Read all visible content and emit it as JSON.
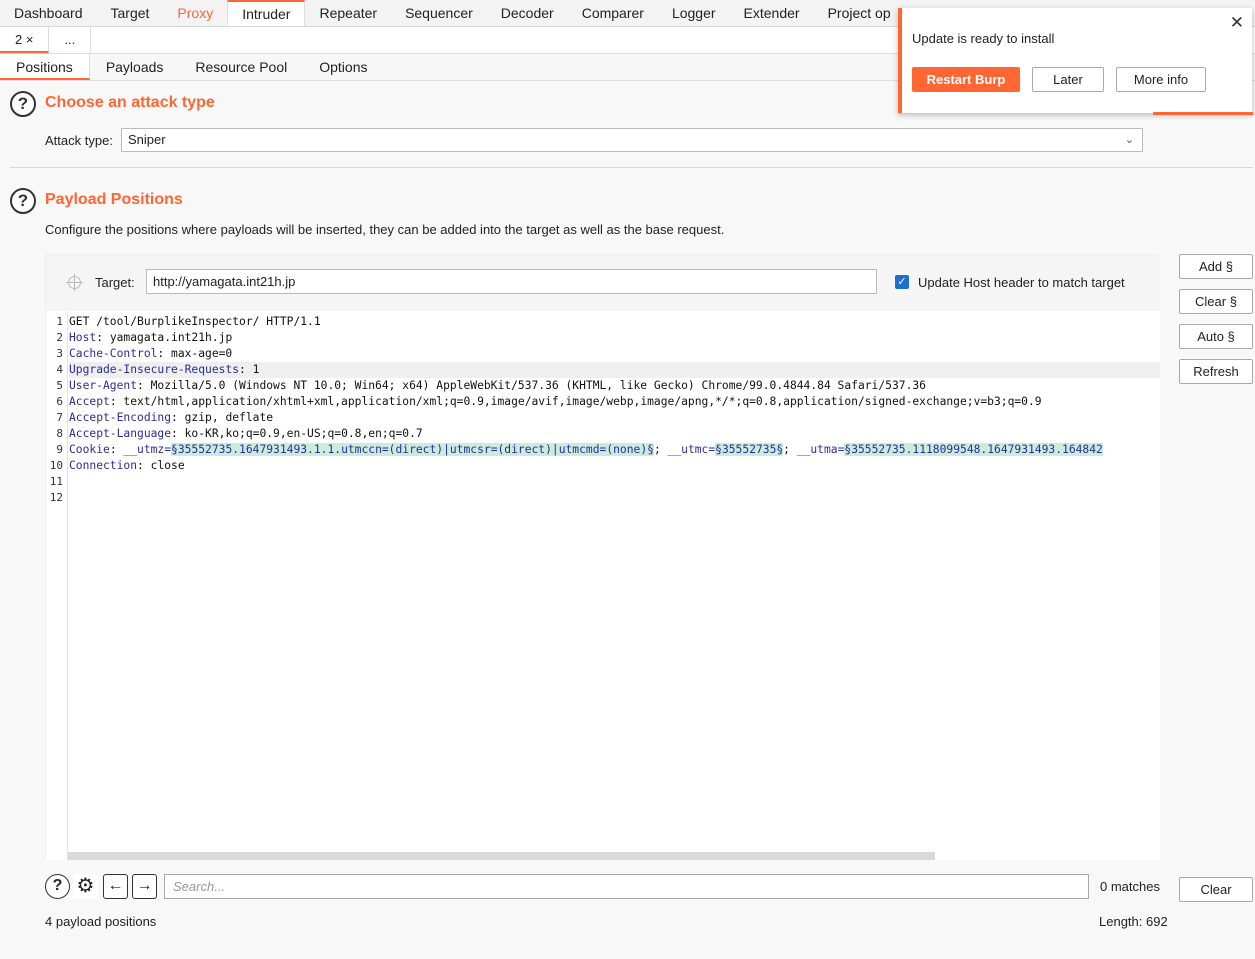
{
  "top_tabs": [
    "Dashboard",
    "Target",
    "Proxy",
    "Intruder",
    "Repeater",
    "Sequencer",
    "Decoder",
    "Comparer",
    "Logger",
    "Extender",
    "Project op"
  ],
  "sub_tabs": [
    "2 ×",
    "..."
  ],
  "inner_tabs": [
    "Positions",
    "Payloads",
    "Resource Pool",
    "Options"
  ],
  "attack": {
    "title": "Choose an attack type",
    "type_label": "Attack type:",
    "type_value": "Sniper"
  },
  "positions": {
    "title": "Payload Positions",
    "description": "Configure the positions where payloads will be inserted, they can be added into the target as well as the base request.",
    "target_label": "Target:",
    "target_value": "http://yamagata.int21h.jp",
    "update_host_label": "Update Host header to match target",
    "update_host_checked": true
  },
  "request": {
    "line_numbers": [
      "1",
      "2",
      "3",
      "4",
      "5",
      "6",
      "7",
      "8",
      "9",
      "10",
      "11",
      "12"
    ],
    "line1": "GET /tool/BurplikeInspector/ HTTP/1.1",
    "headers": [
      {
        "name": "Host",
        "value": ": yamagata.int21h.jp"
      },
      {
        "name": "Cache-Control",
        "value": ": max-age=0"
      },
      {
        "name": "Upgrade-Insecure-Requests",
        "value": ": 1"
      },
      {
        "name": "User-Agent",
        "value": ": Mozilla/5.0 (Windows NT 10.0; Win64; x64) AppleWebKit/537.36 (KHTML, like Gecko) Chrome/99.0.4844.84 Safari/537.36"
      },
      {
        "name": "Accept",
        "value": ": text/html,application/xhtml+xml,application/xml;q=0.9,image/avif,image/webp,image/apng,*/*;q=0.8,application/signed-exchange;v=b3;q=0.9"
      },
      {
        "name": "Accept-Encoding",
        "value": ": gzip, deflate"
      },
      {
        "name": "Accept-Language",
        "value": ": ko-KR,ko;q=0.9,en-US;q=0.8,en;q=0.7"
      }
    ],
    "cookie": {
      "name": "Cookie",
      "sep": ": ",
      "k1": "__utmz=",
      "p1": "§35552735.1647931493.1.1.utmccn=(direct)|utmcsr=(direct)|utmcmd=(none)§",
      "sep2": "; ",
      "k2": "__utmc=",
      "p2": "§35552735§",
      "sep3": "; ",
      "k3": "__utma=",
      "p3": "§35552735.1118099548.1647931493.164842"
    },
    "connection": {
      "name": "Connection",
      "value": ": close"
    }
  },
  "side_buttons": {
    "add": "Add §",
    "clear": "Clear §",
    "auto": "Auto §",
    "refresh": "Refresh"
  },
  "search": {
    "placeholder": "Search...",
    "matches": "0 matches",
    "clear": "Clear"
  },
  "status": {
    "payload_positions": "4 payload positions",
    "length": "Length: 692"
  },
  "popup": {
    "message": "Update is ready to install",
    "restart": "Restart Burp",
    "later": "Later",
    "more": "More info",
    "close": "✕"
  },
  "colors": {
    "accent": "#ff6633",
    "header_name": "#2b2b9e",
    "payload_bg": "#c9ecdc",
    "checkbox": "#1e6fc9"
  }
}
